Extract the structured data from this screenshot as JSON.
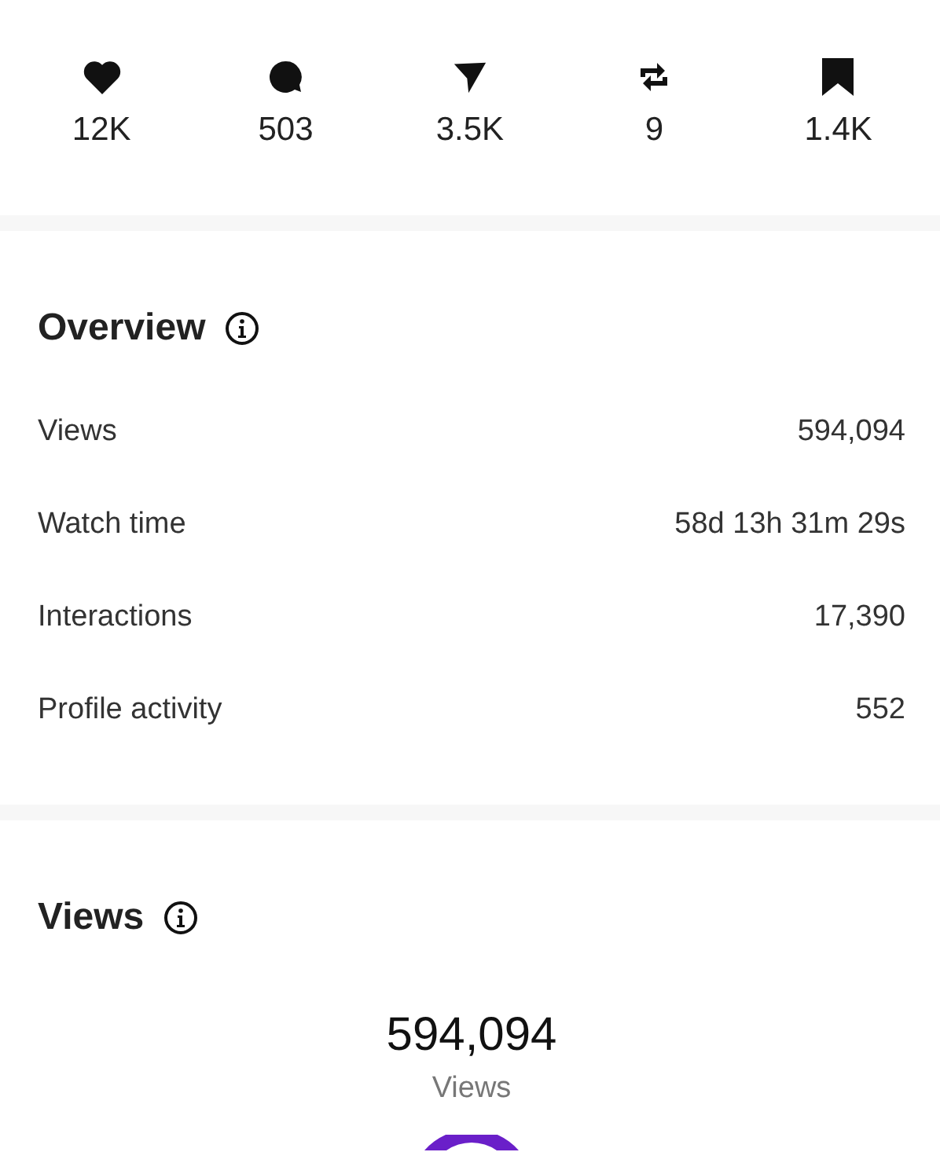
{
  "engagement": [
    {
      "kind": "like",
      "count": "12K"
    },
    {
      "kind": "comment",
      "count": "503"
    },
    {
      "kind": "share",
      "count": "3.5K"
    },
    {
      "kind": "repost",
      "count": "9"
    },
    {
      "kind": "save",
      "count": "1.4K"
    }
  ],
  "overview": {
    "title": "Overview",
    "rows": [
      {
        "label": "Views",
        "value": "594,094"
      },
      {
        "label": "Watch time",
        "value": "58d 13h 31m 29s"
      },
      {
        "label": "Interactions",
        "value": "17,390"
      },
      {
        "label": "Profile activity",
        "value": "552"
      }
    ]
  },
  "views": {
    "title": "Views",
    "total": "594,094",
    "total_label": "Views"
  }
}
